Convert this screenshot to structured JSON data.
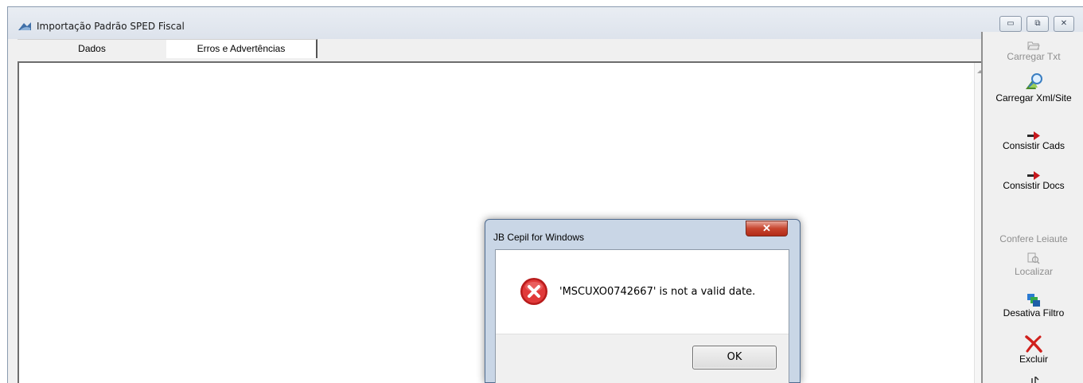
{
  "window": {
    "title": "Importação Padrão SPED Fiscal",
    "controls": {
      "minimize": "▭",
      "maximize": "⧉",
      "close": "✕"
    }
  },
  "tabs": [
    {
      "label": "Dados"
    },
    {
      "label": "Erros e Advertências"
    }
  ],
  "toolbar": {
    "carregar_txt": {
      "label": "Carregar Txt",
      "enabled": false,
      "icon": "folder-open-icon"
    },
    "carregar_xml": {
      "label": "Carregar Xml/Site",
      "enabled": true,
      "icon": "xml-search-icon"
    },
    "consistir_cads": {
      "label": "Consistir Cads",
      "enabled": true,
      "icon": "red-arrow-icon"
    },
    "consistir_docs": {
      "label": "Consistir Docs",
      "enabled": true,
      "icon": "red-arrow-icon"
    },
    "confere_leiaute": {
      "label": "Confere Leiaute",
      "enabled": false
    },
    "localizar": {
      "label": "Localizar",
      "enabled": false,
      "icon": "find-icon"
    },
    "desativa_filtro": {
      "label": "Desativa Filtro",
      "enabled": true,
      "icon": "filter-icon"
    },
    "excluir": {
      "label": "Excluir",
      "enabled": true,
      "icon": "delete-x-icon"
    }
  },
  "dialog": {
    "title": "JB Cepil for Windows",
    "message": "'MSCUXO0742667' is not a valid date.",
    "ok_label": "OK",
    "close_glyph": "✕"
  },
  "colors": {
    "error_red": "#d42a2a",
    "disabled_text": "#8f8f8f",
    "close_button": "#c7452e"
  }
}
